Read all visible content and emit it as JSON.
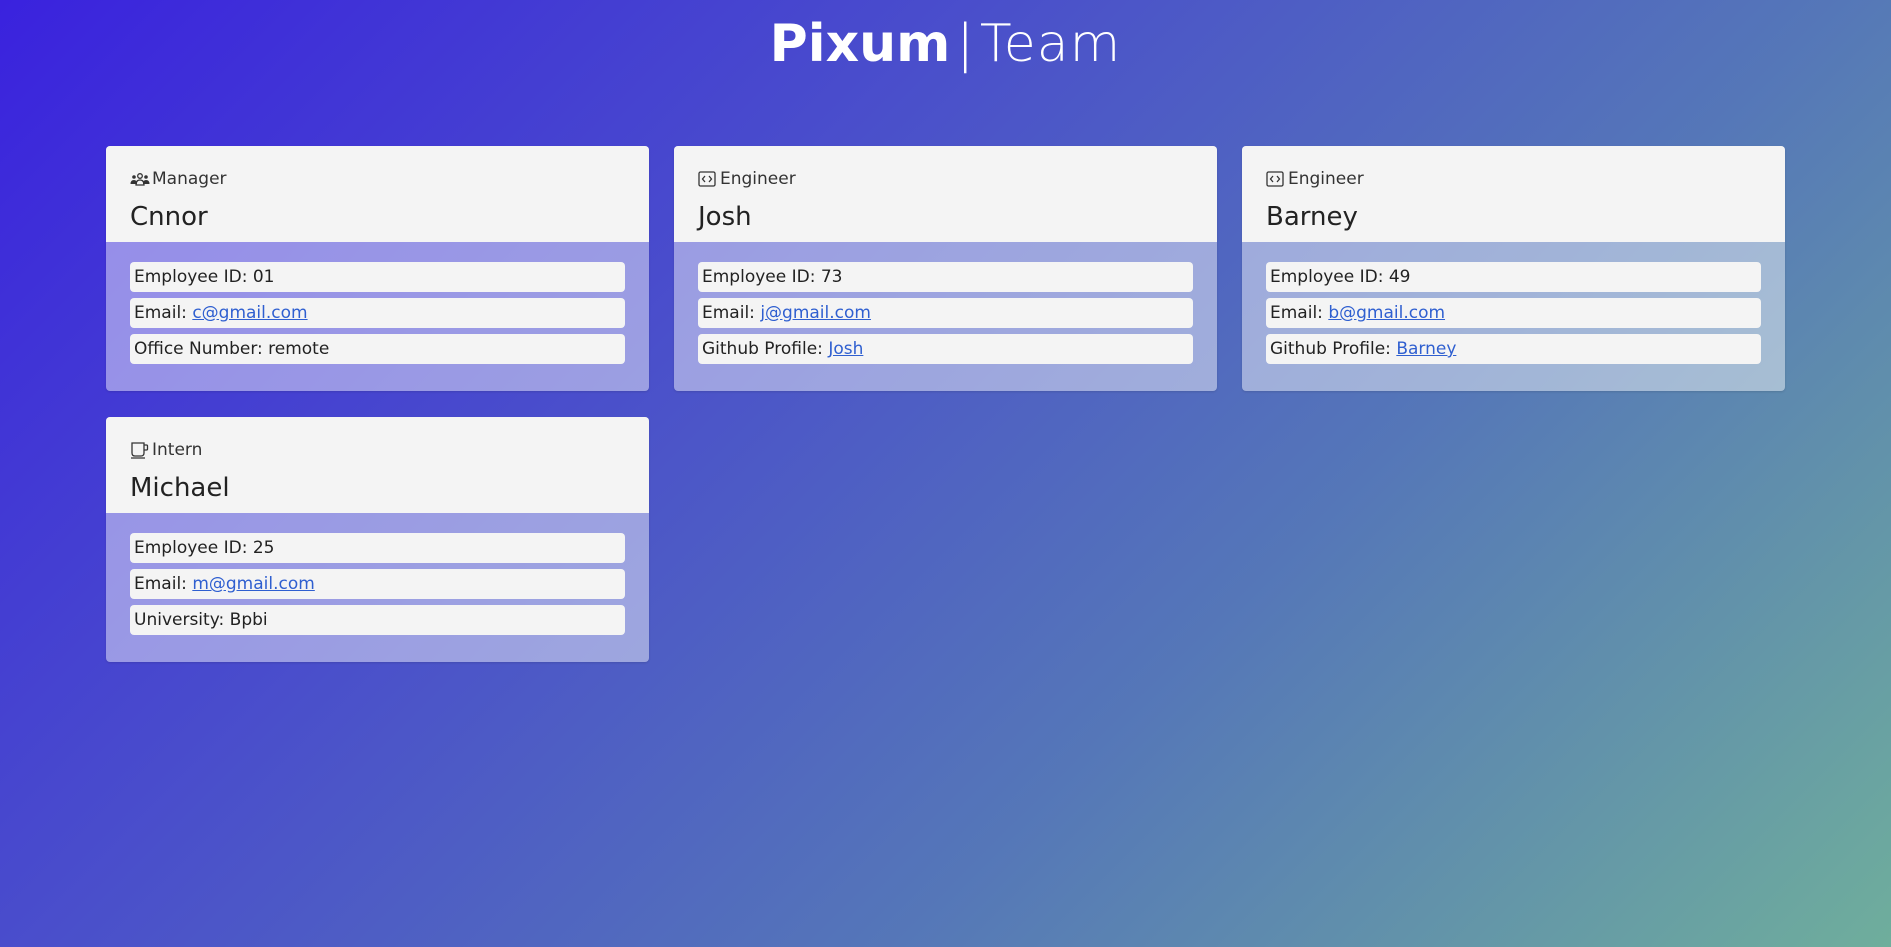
{
  "header": {
    "brand": "Pixum",
    "separator": "|",
    "section": "Team"
  },
  "employees": [
    {
      "role": "Manager",
      "role_icon": "manager-icon",
      "name": "Cnnor",
      "id_label": "Employee ID: 01",
      "email_label": "Email:",
      "email": "c@gmail.com",
      "extra_label": "Office Number: remote",
      "extra_link": ""
    },
    {
      "role": "Engineer",
      "role_icon": "code-icon",
      "name": "Josh",
      "id_label": "Employee ID: 73",
      "email_label": "Email:",
      "email": "j@gmail.com",
      "extra_label": "Github Profile:",
      "extra_link": "Josh"
    },
    {
      "role": "Engineer",
      "role_icon": "code-icon",
      "name": "Barney",
      "id_label": "Employee ID: 49",
      "email_label": "Email:",
      "email": "b@gmail.com",
      "extra_label": "Github Profile:",
      "extra_link": "Barney"
    },
    {
      "role": "Intern",
      "role_icon": "cup-icon",
      "name": "Michael",
      "id_label": "Employee ID: 25",
      "email_label": "Email:",
      "email": "m@gmail.com",
      "extra_label": "University: Bpbi",
      "extra_link": ""
    }
  ],
  "colors": {
    "link": "#2f5fd0",
    "card_header": "#f4f4f4",
    "gradient_start": "#3a22de",
    "gradient_end": "#6fae9c"
  }
}
